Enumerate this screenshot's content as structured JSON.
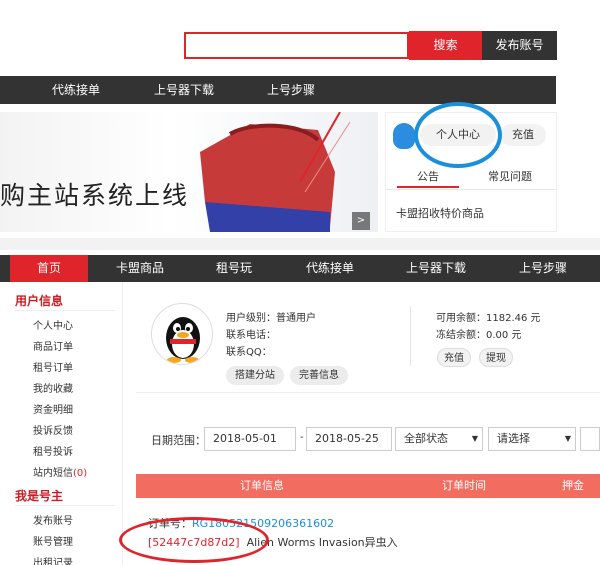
{
  "search": {
    "placeholder": "",
    "button_label": "搜索"
  },
  "publish_label": "发布账号",
  "top_nav": [
    "代练接单",
    "上号器下载",
    "上号步骤"
  ],
  "banner": {
    "text": "购主站系统上线"
  },
  "right_panel": {
    "personal_center": "个人中心",
    "recharge": "充值",
    "tab_announcement": "公告",
    "tab_faq": "常见问题",
    "announcement_item": "卡盟招收特价商品"
  },
  "main_nav": [
    "首页",
    "卡盟商品",
    "租号玩",
    "代练接单",
    "上号器下载",
    "上号步骤"
  ],
  "sidebar": {
    "user_info_title": "用户信息",
    "user_items": [
      "个人中心",
      "商品订单",
      "租号订单",
      "我的收藏",
      "资金明细",
      "投诉反馈",
      "租号投诉"
    ],
    "messages_label": "站内短信",
    "messages_count": "0",
    "owner_title": "我是号主",
    "owner_items": [
      "发布账号",
      "账号管理",
      "出租记录"
    ]
  },
  "user_card": {
    "level": "用户级别：普通用户",
    "phone": "联系电话：",
    "qq": "联系QQ：",
    "build_station": "搭建分站",
    "complete_info": "完善信息",
    "balance": "可用余额：1182.46 元",
    "frozen": "冻结余额：0.00 元",
    "recharge": "充值",
    "withdraw": "提现"
  },
  "filter": {
    "date_range_label": "日期范围：",
    "start_date": "2018-05-01",
    "separator": "-",
    "end_date": "2018-05-25",
    "status": "全部状态",
    "select": "请选择"
  },
  "order_table": {
    "headers": [
      "订单信息",
      "订单时间",
      "押金"
    ],
    "order_no_label": "订单号：",
    "order_no": "RG180521509206361602",
    "code": "[52447c7d87d2]",
    "game": "Alien Worms Invasion异虫入"
  },
  "colors": {
    "accent": "#e0242b",
    "nav_bg": "#333333",
    "link": "#1a8fdc",
    "table_header": "#f36c60"
  }
}
